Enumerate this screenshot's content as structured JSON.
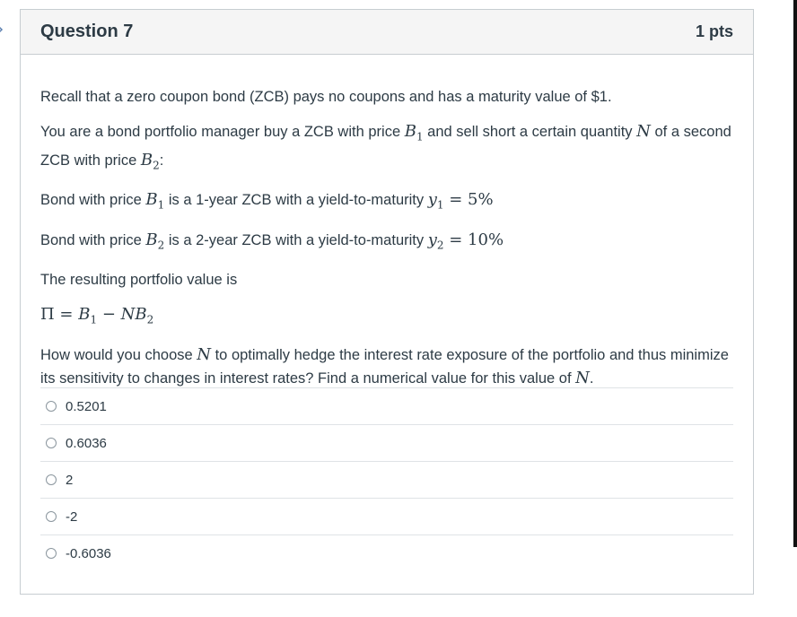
{
  "question": {
    "title": "Question 7",
    "points": "1 pts",
    "paragraphs": {
      "p1": "Recall that a zero coupon bond (ZCB) pays no coupons and has a maturity value of $1.",
      "p2_a": "You are a bond portfolio manager buy a ZCB with price ",
      "p2_b": " and sell short a certain quantity ",
      "p2_c": " of a second ZCB with price ",
      "p2_d": ":",
      "p3_a": "Bond with price ",
      "p3_b": " is a 1-year ZCB with a yield-to-maturity ",
      "p4_a": "Bond with price ",
      "p4_b": " is a 2-year ZCB with a yield-to-maturity ",
      "p5": "The resulting portfolio value is",
      "p7_a": "How would you choose ",
      "p7_b": " to optimally hedge the interest rate exposure of the portfolio and thus minimize its sensitivity to changes in interest rates? Find a numerical value for this value of ",
      "p7_c": "."
    },
    "math": {
      "B": "B",
      "one": "1",
      "two": "2",
      "N": "N",
      "y": "y",
      "eq_5": " = 5%",
      "eq_10": " = 10%",
      "pi": "Π = ",
      "minus": " − ",
      "NB": "NB"
    },
    "answers": [
      {
        "label": "0.5201"
      },
      {
        "label": "0.6036"
      },
      {
        "label": "2"
      },
      {
        "label": "-2"
      },
      {
        "label": "-0.6036"
      }
    ]
  }
}
